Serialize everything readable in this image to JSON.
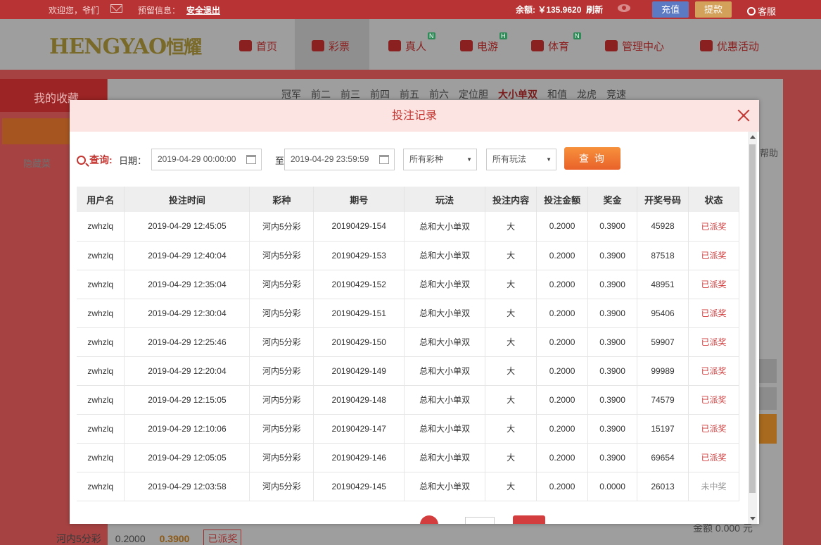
{
  "topbar": {
    "welcome": "欢迎您，爷们",
    "notice_label": "预留信息：",
    "logout": "安全退出",
    "balance": "余额: ￥135.9620",
    "refresh": "刷新",
    "recharge": "充值",
    "withdraw": "提款",
    "service": "客服"
  },
  "nav": {
    "logo": "HENGYAO",
    "logo_cn": "恒耀",
    "items": [
      "首页",
      "彩票",
      "真人",
      "电游",
      "体育",
      "管理中心",
      "优惠活动"
    ],
    "badges": [
      "N",
      "H",
      "N"
    ]
  },
  "background": {
    "favorites": "我的收藏",
    "hide_menu": "隐藏菜",
    "lottery_tabs": [
      "冠军",
      "前二",
      "前三",
      "前四",
      "前五",
      "前六",
      "定位胆",
      "大小单双",
      "和值",
      "龙虎",
      "竞速"
    ],
    "bottom_game": "河内5分彩",
    "bottom_amount": "0.2000",
    "bottom_prize": "0.3900",
    "bottom_status": "已派奖",
    "total": "金额 0.000 元",
    "help": "帮助"
  },
  "modal": {
    "title": "投注记录",
    "query_label": "查询:",
    "date_label": "日期：",
    "date_from": "2019-04-29 00:00:00",
    "to": "至",
    "date_to": "2019-04-29 23:59:59",
    "lottery_select": "所有彩种",
    "play_select": "所有玩法",
    "query_button": "查 询"
  },
  "table": {
    "headers": [
      "用户名",
      "投注时间",
      "彩种",
      "期号",
      "玩法",
      "投注内容",
      "投注金额",
      "奖金",
      "开奖号码",
      "状态"
    ],
    "rows": [
      [
        "zwhzlq",
        "2019-04-29 12:45:05",
        "河内5分彩",
        "20190429-154",
        "总和大小单双",
        "大",
        "0.2000",
        "0.3900",
        "45928",
        "已派奖"
      ],
      [
        "zwhzlq",
        "2019-04-29 12:40:04",
        "河内5分彩",
        "20190429-153",
        "总和大小单双",
        "大",
        "0.2000",
        "0.3900",
        "87518",
        "已派奖"
      ],
      [
        "zwhzlq",
        "2019-04-29 12:35:04",
        "河内5分彩",
        "20190429-152",
        "总和大小单双",
        "大",
        "0.2000",
        "0.3900",
        "48951",
        "已派奖"
      ],
      [
        "zwhzlq",
        "2019-04-29 12:30:04",
        "河内5分彩",
        "20190429-151",
        "总和大小单双",
        "大",
        "0.2000",
        "0.3900",
        "95406",
        "已派奖"
      ],
      [
        "zwhzlq",
        "2019-04-29 12:25:46",
        "河内5分彩",
        "20190429-150",
        "总和大小单双",
        "大",
        "0.2000",
        "0.3900",
        "59907",
        "已派奖"
      ],
      [
        "zwhzlq",
        "2019-04-29 12:20:04",
        "河内5分彩",
        "20190429-149",
        "总和大小单双",
        "大",
        "0.2000",
        "0.3900",
        "99989",
        "已派奖"
      ],
      [
        "zwhzlq",
        "2019-04-29 12:15:05",
        "河内5分彩",
        "20190429-148",
        "总和大小单双",
        "大",
        "0.2000",
        "0.3900",
        "74579",
        "已派奖"
      ],
      [
        "zwhzlq",
        "2019-04-29 12:10:06",
        "河内5分彩",
        "20190429-147",
        "总和大小单双",
        "大",
        "0.2000",
        "0.3900",
        "15197",
        "已派奖"
      ],
      [
        "zwhzlq",
        "2019-04-29 12:05:05",
        "河内5分彩",
        "20190429-146",
        "总和大小单双",
        "大",
        "0.2000",
        "0.3900",
        "69654",
        "已派奖"
      ],
      [
        "zwhzlq",
        "2019-04-29 12:03:58",
        "河内5分彩",
        "20190429-145",
        "总和大小单双",
        "大",
        "0.2000",
        "0.0000",
        "26013",
        "未中奖"
      ]
    ]
  }
}
